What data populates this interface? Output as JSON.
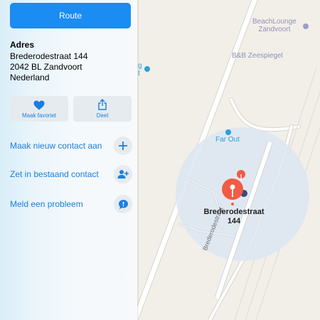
{
  "map": {
    "poi_beachlounge_line1": "BeachLounge",
    "poi_beachlounge_line2": "Zandvoort",
    "poi_bnb": "B&B Zeespiegel",
    "poi_farout": "Far Out",
    "poi_partial_line1": "g",
    "poi_partial_line2": "t",
    "marker_label_line1": "Brederodestraat",
    "marker_label_line2": "144",
    "street_label": "Brederodestraat",
    "colors": {
      "accent": "#1a8cf2",
      "pin": "#f25b45",
      "range": "#dce6f2",
      "poi": "#2aa0d8"
    }
  },
  "panel": {
    "route_label": "Route",
    "address_title": "Adres",
    "address_lines": [
      "Brederodestraat 144",
      "2042 BL Zandvoort",
      "Nederland"
    ],
    "actions": [
      {
        "label": "Maak favoriet",
        "icon": "heart-icon"
      },
      {
        "label": "Deel",
        "icon": "share-icon"
      }
    ],
    "rows": [
      {
        "label": "Maak nieuw contact aan",
        "icon": "plus-icon"
      },
      {
        "label": "Zet in bestaand contact",
        "icon": "add-contact-icon"
      },
      {
        "label": "Meld een probleem",
        "icon": "report-bubble-icon"
      }
    ]
  }
}
